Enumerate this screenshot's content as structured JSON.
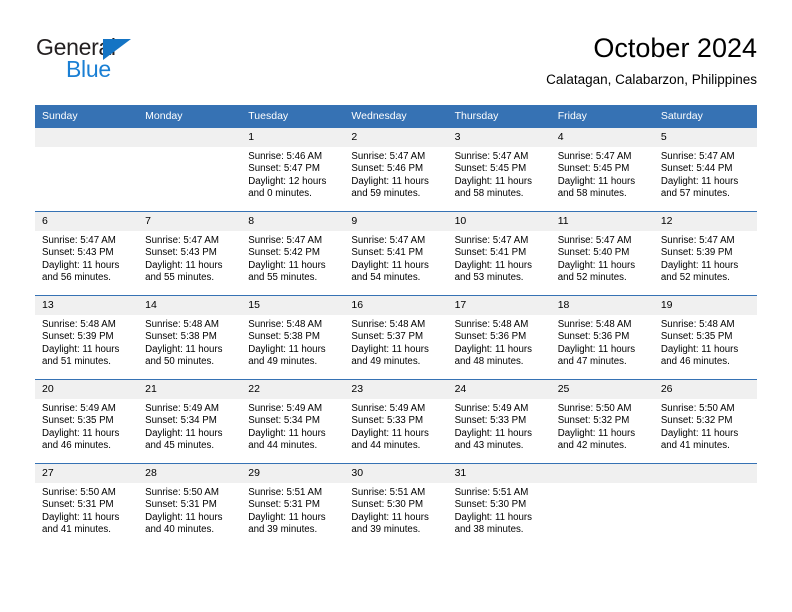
{
  "brand": {
    "name_part1": "General",
    "name_part2": "Blue",
    "triangle_color": "#1474c4",
    "blue_color": "#1a7fd4"
  },
  "header": {
    "title": "October 2024",
    "subtitle": "Calatagan, Calabarzon, Philippines"
  },
  "theme": {
    "header_blue": "#3672b4",
    "daynum_band": "#f0f0f0"
  },
  "calendar": {
    "weekday_headers": [
      "Sunday",
      "Monday",
      "Tuesday",
      "Wednesday",
      "Thursday",
      "Friday",
      "Saturday"
    ],
    "labels": {
      "sunrise": "Sunrise:",
      "sunset": "Sunset:",
      "daylight": "Daylight:"
    },
    "weeks": [
      [
        {
          "day": "",
          "empty": true
        },
        {
          "day": "",
          "empty": true
        },
        {
          "day": "1",
          "sunrise": "Sunrise: 5:46 AM",
          "sunset": "Sunset: 5:47 PM",
          "daylight": "Daylight: 12 hours and 0 minutes."
        },
        {
          "day": "2",
          "sunrise": "Sunrise: 5:47 AM",
          "sunset": "Sunset: 5:46 PM",
          "daylight": "Daylight: 11 hours and 59 minutes."
        },
        {
          "day": "3",
          "sunrise": "Sunrise: 5:47 AM",
          "sunset": "Sunset: 5:45 PM",
          "daylight": "Daylight: 11 hours and 58 minutes."
        },
        {
          "day": "4",
          "sunrise": "Sunrise: 5:47 AM",
          "sunset": "Sunset: 5:45 PM",
          "daylight": "Daylight: 11 hours and 58 minutes."
        },
        {
          "day": "5",
          "sunrise": "Sunrise: 5:47 AM",
          "sunset": "Sunset: 5:44 PM",
          "daylight": "Daylight: 11 hours and 57 minutes."
        }
      ],
      [
        {
          "day": "6",
          "sunrise": "Sunrise: 5:47 AM",
          "sunset": "Sunset: 5:43 PM",
          "daylight": "Daylight: 11 hours and 56 minutes."
        },
        {
          "day": "7",
          "sunrise": "Sunrise: 5:47 AM",
          "sunset": "Sunset: 5:43 PM",
          "daylight": "Daylight: 11 hours and 55 minutes."
        },
        {
          "day": "8",
          "sunrise": "Sunrise: 5:47 AM",
          "sunset": "Sunset: 5:42 PM",
          "daylight": "Daylight: 11 hours and 55 minutes."
        },
        {
          "day": "9",
          "sunrise": "Sunrise: 5:47 AM",
          "sunset": "Sunset: 5:41 PM",
          "daylight": "Daylight: 11 hours and 54 minutes."
        },
        {
          "day": "10",
          "sunrise": "Sunrise: 5:47 AM",
          "sunset": "Sunset: 5:41 PM",
          "daylight": "Daylight: 11 hours and 53 minutes."
        },
        {
          "day": "11",
          "sunrise": "Sunrise: 5:47 AM",
          "sunset": "Sunset: 5:40 PM",
          "daylight": "Daylight: 11 hours and 52 minutes."
        },
        {
          "day": "12",
          "sunrise": "Sunrise: 5:47 AM",
          "sunset": "Sunset: 5:39 PM",
          "daylight": "Daylight: 11 hours and 52 minutes."
        }
      ],
      [
        {
          "day": "13",
          "sunrise": "Sunrise: 5:48 AM",
          "sunset": "Sunset: 5:39 PM",
          "daylight": "Daylight: 11 hours and 51 minutes."
        },
        {
          "day": "14",
          "sunrise": "Sunrise: 5:48 AM",
          "sunset": "Sunset: 5:38 PM",
          "daylight": "Daylight: 11 hours and 50 minutes."
        },
        {
          "day": "15",
          "sunrise": "Sunrise: 5:48 AM",
          "sunset": "Sunset: 5:38 PM",
          "daylight": "Daylight: 11 hours and 49 minutes."
        },
        {
          "day": "16",
          "sunrise": "Sunrise: 5:48 AM",
          "sunset": "Sunset: 5:37 PM",
          "daylight": "Daylight: 11 hours and 49 minutes."
        },
        {
          "day": "17",
          "sunrise": "Sunrise: 5:48 AM",
          "sunset": "Sunset: 5:36 PM",
          "daylight": "Daylight: 11 hours and 48 minutes."
        },
        {
          "day": "18",
          "sunrise": "Sunrise: 5:48 AM",
          "sunset": "Sunset: 5:36 PM",
          "daylight": "Daylight: 11 hours and 47 minutes."
        },
        {
          "day": "19",
          "sunrise": "Sunrise: 5:48 AM",
          "sunset": "Sunset: 5:35 PM",
          "daylight": "Daylight: 11 hours and 46 minutes."
        }
      ],
      [
        {
          "day": "20",
          "sunrise": "Sunrise: 5:49 AM",
          "sunset": "Sunset: 5:35 PM",
          "daylight": "Daylight: 11 hours and 46 minutes."
        },
        {
          "day": "21",
          "sunrise": "Sunrise: 5:49 AM",
          "sunset": "Sunset: 5:34 PM",
          "daylight": "Daylight: 11 hours and 45 minutes."
        },
        {
          "day": "22",
          "sunrise": "Sunrise: 5:49 AM",
          "sunset": "Sunset: 5:34 PM",
          "daylight": "Daylight: 11 hours and 44 minutes."
        },
        {
          "day": "23",
          "sunrise": "Sunrise: 5:49 AM",
          "sunset": "Sunset: 5:33 PM",
          "daylight": "Daylight: 11 hours and 44 minutes."
        },
        {
          "day": "24",
          "sunrise": "Sunrise: 5:49 AM",
          "sunset": "Sunset: 5:33 PM",
          "daylight": "Daylight: 11 hours and 43 minutes."
        },
        {
          "day": "25",
          "sunrise": "Sunrise: 5:50 AM",
          "sunset": "Sunset: 5:32 PM",
          "daylight": "Daylight: 11 hours and 42 minutes."
        },
        {
          "day": "26",
          "sunrise": "Sunrise: 5:50 AM",
          "sunset": "Sunset: 5:32 PM",
          "daylight": "Daylight: 11 hours and 41 minutes."
        }
      ],
      [
        {
          "day": "27",
          "sunrise": "Sunrise: 5:50 AM",
          "sunset": "Sunset: 5:31 PM",
          "daylight": "Daylight: 11 hours and 41 minutes."
        },
        {
          "day": "28",
          "sunrise": "Sunrise: 5:50 AM",
          "sunset": "Sunset: 5:31 PM",
          "daylight": "Daylight: 11 hours and 40 minutes."
        },
        {
          "day": "29",
          "sunrise": "Sunrise: 5:51 AM",
          "sunset": "Sunset: 5:31 PM",
          "daylight": "Daylight: 11 hours and 39 minutes."
        },
        {
          "day": "30",
          "sunrise": "Sunrise: 5:51 AM",
          "sunset": "Sunset: 5:30 PM",
          "daylight": "Daylight: 11 hours and 39 minutes."
        },
        {
          "day": "31",
          "sunrise": "Sunrise: 5:51 AM",
          "sunset": "Sunset: 5:30 PM",
          "daylight": "Daylight: 11 hours and 38 minutes."
        },
        {
          "day": "",
          "empty": true
        },
        {
          "day": "",
          "empty": true
        }
      ]
    ]
  }
}
